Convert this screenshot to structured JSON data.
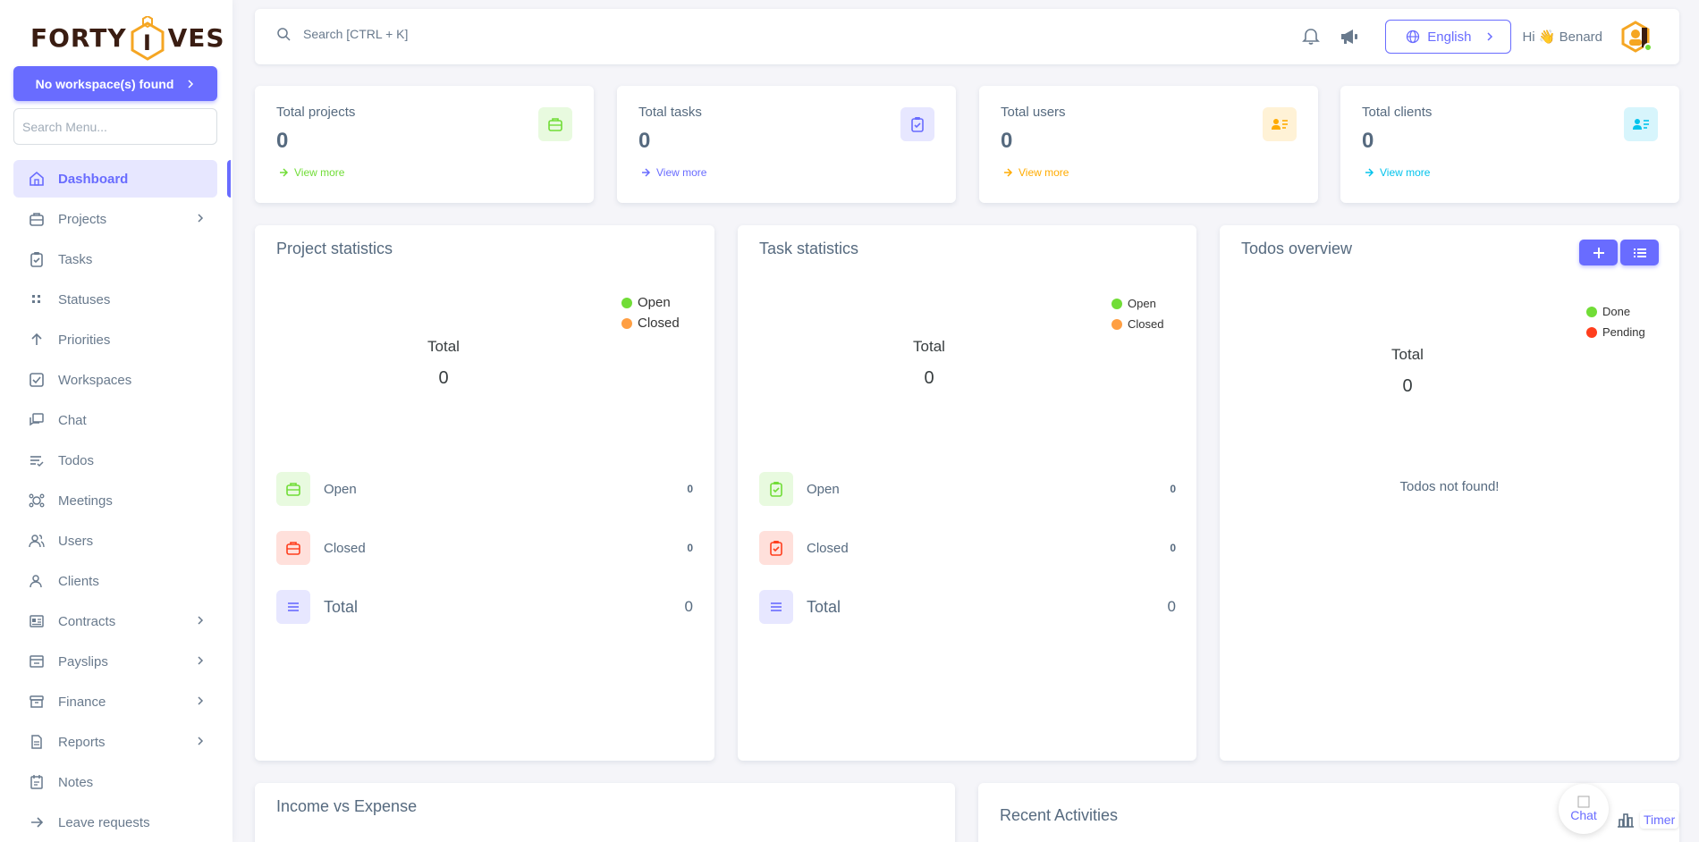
{
  "brand": {
    "logo_left": "FORTY",
    "logo_right": "VES",
    "logo_mid": "I"
  },
  "sidebar": {
    "workspace_button": "No workspace(s) found",
    "search_placeholder": "Search Menu...",
    "items": [
      {
        "label": "Dashboard",
        "icon": "home-icon",
        "active": true,
        "has_children": false
      },
      {
        "label": "Projects",
        "icon": "briefcase-icon",
        "has_children": true
      },
      {
        "label": "Tasks",
        "icon": "clipboard-check-icon",
        "has_children": false
      },
      {
        "label": "Statuses",
        "icon": "grid-dots-icon",
        "has_children": false
      },
      {
        "label": "Priorities",
        "icon": "arrow-up-icon",
        "has_children": false
      },
      {
        "label": "Workspaces",
        "icon": "checkbox-icon",
        "has_children": false
      },
      {
        "label": "Chat",
        "icon": "chat-icon",
        "has_children": false
      },
      {
        "label": "Todos",
        "icon": "list-check-icon",
        "has_children": false
      },
      {
        "label": "Meetings",
        "icon": "meetings-icon",
        "has_children": false
      },
      {
        "label": "Users",
        "icon": "users-icon",
        "has_children": false
      },
      {
        "label": "Clients",
        "icon": "clients-icon",
        "has_children": false
      },
      {
        "label": "Contracts",
        "icon": "contract-icon",
        "has_children": true
      },
      {
        "label": "Payslips",
        "icon": "payslip-icon",
        "has_children": true
      },
      {
        "label": "Finance",
        "icon": "finance-icon",
        "has_children": true
      },
      {
        "label": "Reports",
        "icon": "report-icon",
        "has_children": true
      },
      {
        "label": "Notes",
        "icon": "notes-icon",
        "has_children": false
      },
      {
        "label": "Leave requests",
        "icon": "arrow-right-icon",
        "has_children": false
      }
    ]
  },
  "topbar": {
    "search_placeholder": "Search [CTRL + K]",
    "language": "English",
    "greeting": "Hi 👋 Benard"
  },
  "stats": [
    {
      "title": "Total projects",
      "value": "0",
      "link": "View more",
      "color": "#71dd37",
      "bg": "#e8fadf",
      "icon": "briefcase-icon"
    },
    {
      "title": "Total tasks",
      "value": "0",
      "link": "View more",
      "color": "#696cff",
      "bg": "#e7e7ff",
      "icon": "clipboard-check-icon"
    },
    {
      "title": "Total users",
      "value": "0",
      "link": "View more",
      "color": "#ffab00",
      "bg": "#fff2d6",
      "icon": "user-card-icon"
    },
    {
      "title": "Total clients",
      "value": "0",
      "link": "View more",
      "color": "#03c3ec",
      "bg": "#d7f5fc",
      "icon": "user-card-icon"
    }
  ],
  "project_stats": {
    "title": "Project statistics",
    "legend": [
      {
        "label": "Open",
        "color": "#71dd37"
      },
      {
        "label": "Closed",
        "color": "#ff9f43"
      }
    ],
    "center_label": "Total",
    "center_value": "0",
    "rows": [
      {
        "label": "Open",
        "value": "0",
        "color": "#71dd37",
        "bg": "#e8fadf"
      },
      {
        "label": "Closed",
        "value": "0",
        "color": "#ff3e1d",
        "bg": "#ffe0db"
      },
      {
        "label": "Total",
        "value": "0",
        "color": "#696cff",
        "bg": "#e7e7ff"
      }
    ]
  },
  "task_stats": {
    "title": "Task statistics",
    "legend": [
      {
        "label": "Open",
        "color": "#71dd37"
      },
      {
        "label": "Closed",
        "color": "#ff9f43"
      }
    ],
    "center_label": "Total",
    "center_value": "0",
    "rows": [
      {
        "label": "Open",
        "value": "0",
        "color": "#71dd37",
        "bg": "#e8fadf"
      },
      {
        "label": "Closed",
        "value": "0",
        "color": "#ff3e1d",
        "bg": "#ffe0db"
      },
      {
        "label": "Total",
        "value": "0",
        "color": "#696cff",
        "bg": "#e7e7ff"
      }
    ]
  },
  "todos": {
    "title": "Todos overview",
    "legend": [
      {
        "label": "Done",
        "color": "#71dd37"
      },
      {
        "label": "Pending",
        "color": "#ff3e1d"
      }
    ],
    "center_label": "Total",
    "center_value": "0",
    "empty": "Todos not found!"
  },
  "bottom": {
    "income_title": "Income vs Expense",
    "activities_title": "Recent Activities"
  },
  "floating": {
    "chat": "Chat",
    "timer": "Timer"
  },
  "colors": {
    "accent": "#696cff",
    "text": "#566a7f",
    "background": "#f5f5f9"
  }
}
